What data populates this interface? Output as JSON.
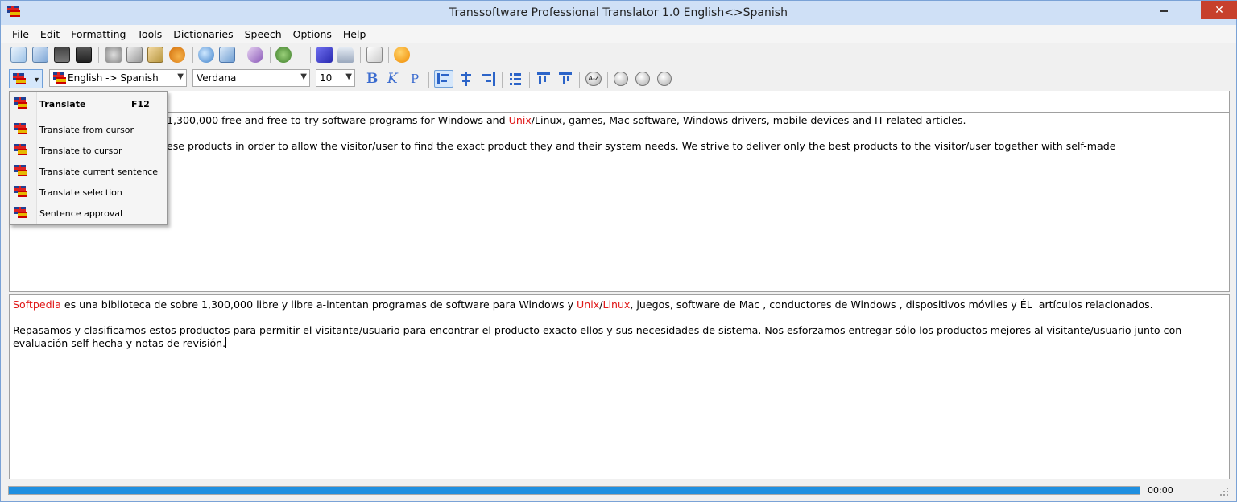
{
  "window": {
    "title": "Transsoftware Professional Translator 1.0 English<>Spanish",
    "close_label": "✕"
  },
  "menu": {
    "items": [
      "File",
      "Edit",
      "Formatting",
      "Tools",
      "Dictionaries",
      "Speech",
      "Options",
      "Help"
    ]
  },
  "toolbar": {
    "direction": "English -> Spanish",
    "font": "Verdana",
    "size": "10",
    "bold": "B",
    "italic": "K",
    "underline": "P",
    "sort_label": "A-Z"
  },
  "dropdown": {
    "items": [
      {
        "label": "Translate",
        "shortcut": "F12"
      },
      {
        "label": "Translate from cursor"
      },
      {
        "label": "Translate to cursor"
      },
      {
        "label": "Translate current sentence"
      },
      {
        "label": "Translate selection"
      },
      {
        "label": "Sentence approval"
      }
    ]
  },
  "source": {
    "line1_a": "1,300,000 free and free-to-try software programs for Windows and ",
    "line1_red": "Unix",
    "line1_b": "/Linux, games, Mac software, Windows drivers, mobile devices and IT-related articles.",
    "line2": "ese products in order to allow the visitor/user to find the exact product they and their system needs. We strive to deliver only the best products to the visitor/user together with self-made"
  },
  "target": {
    "p1_red1": "Softpedia",
    "p1_a": " es una biblioteca de sobre 1,300,000 libre y libre a-intentan programas de software para Windows y ",
    "p1_red2": "Unix",
    "p1_slash": "/",
    "p1_red3": "Linux",
    "p1_b": ", juegos, software de Mac , conductores de Windows , dispositivos móviles y ÉL  artículos relacionados.",
    "p2": "Repasamos y clasificamos estos productos para permitir el visitante/usuario para encontrar el producto exacto ellos y sus necesidades de sistema. Nos esforzamos entregar sólo los productos mejores al visitante/usuario junto con evaluación self-hecha y notas de revisión."
  },
  "status": {
    "time": "00:00",
    "progress": 1.0
  },
  "colors": {
    "accent": "#1e8fe0",
    "highlight_red": "#e01818",
    "close": "#c7402c"
  }
}
